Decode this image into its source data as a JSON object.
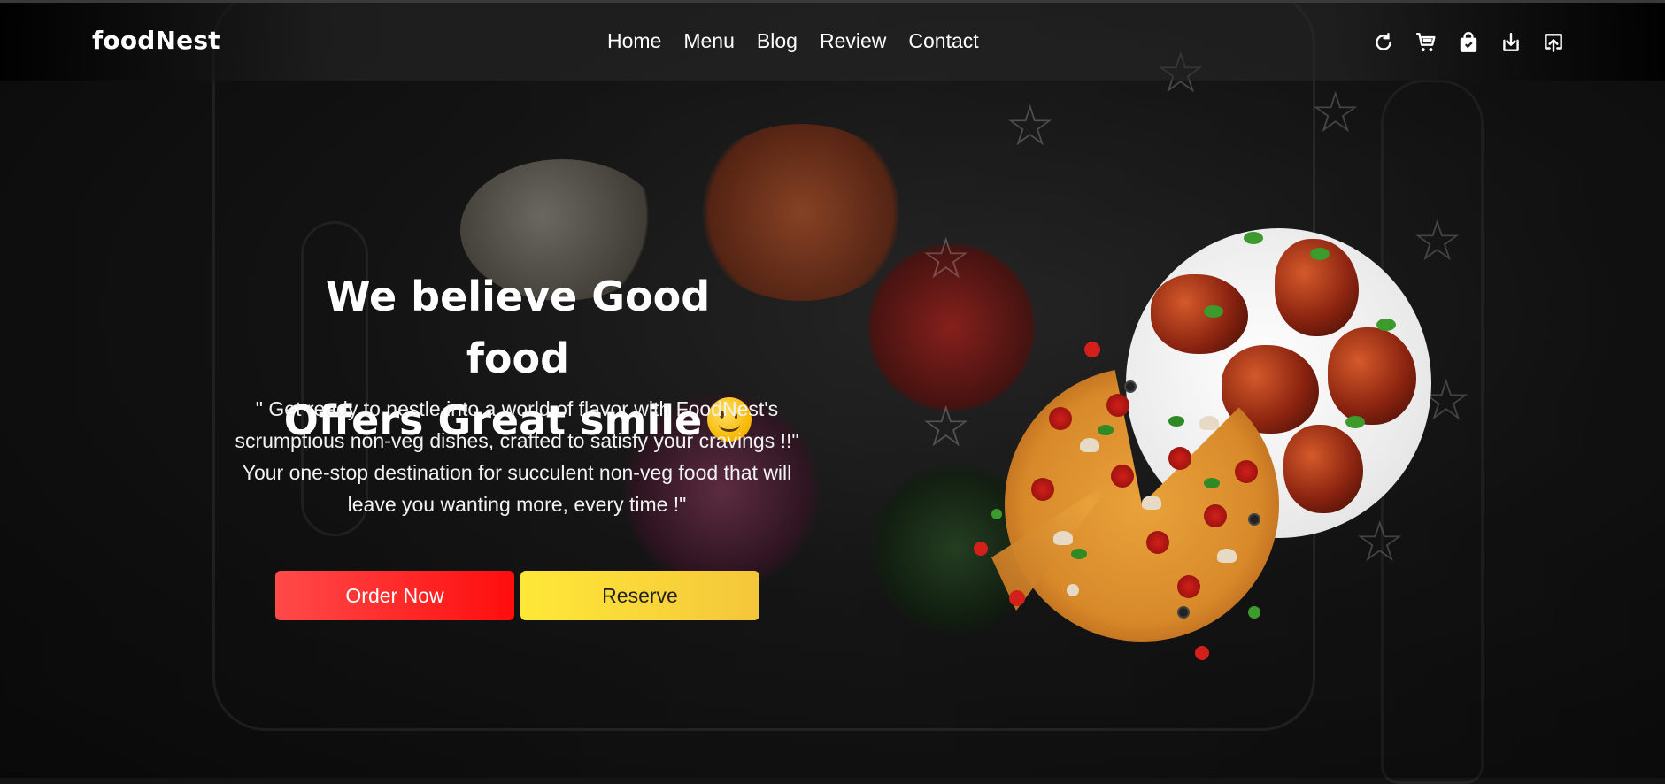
{
  "brand": {
    "logo": "foodNest"
  },
  "nav": {
    "links": [
      "Home",
      "Menu",
      "Blog",
      "Review",
      "Contact"
    ],
    "icons": [
      "refresh-icon",
      "cart-icon",
      "shopping-bag-icon",
      "download-icon",
      "upload-icon"
    ]
  },
  "hero": {
    "title_line1": "We believe Good food",
    "title_line2": "Offers Great smile",
    "subtitle": "\" Get ready to nestle into a world of flavor with FoodNest's scrumptious non-veg dishes, crafted to satisfy your cravings !!\" Your one-stop destination for succulent non-veg food that will leave you wanting more, every time !\"",
    "order_button": "Order Now",
    "reserve_button": "Reserve"
  },
  "colors": {
    "order_button": "#ff0d0d",
    "reserve_button": "#f9e130",
    "background": "#141414"
  }
}
